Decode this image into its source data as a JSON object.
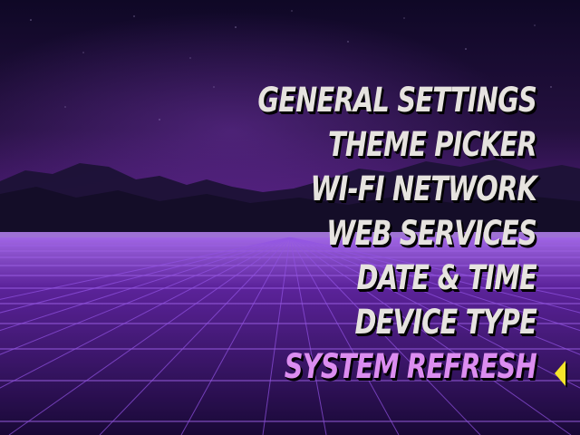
{
  "menu": {
    "items": [
      {
        "label": "GENERAL SETTINGS",
        "selected": false
      },
      {
        "label": "THEME PICKER",
        "selected": false
      },
      {
        "label": "WI-FI NETWORK",
        "selected": false
      },
      {
        "label": "WEB SERVICES",
        "selected": false
      },
      {
        "label": "DATE & TIME",
        "selected": false
      },
      {
        "label": "DEVICE TYPE",
        "selected": false
      },
      {
        "label": "SYSTEM REFRESH",
        "selected": true
      }
    ],
    "selector_icon": "triangle-left-icon"
  },
  "colors": {
    "text": "#e6e3df",
    "selected": "#dc8df0",
    "selector": "#f6e52a",
    "sky_top": "#160b33",
    "sky_horizon": "#3f1668",
    "floor": "#6a2bb8",
    "grid": "#b16cff"
  }
}
